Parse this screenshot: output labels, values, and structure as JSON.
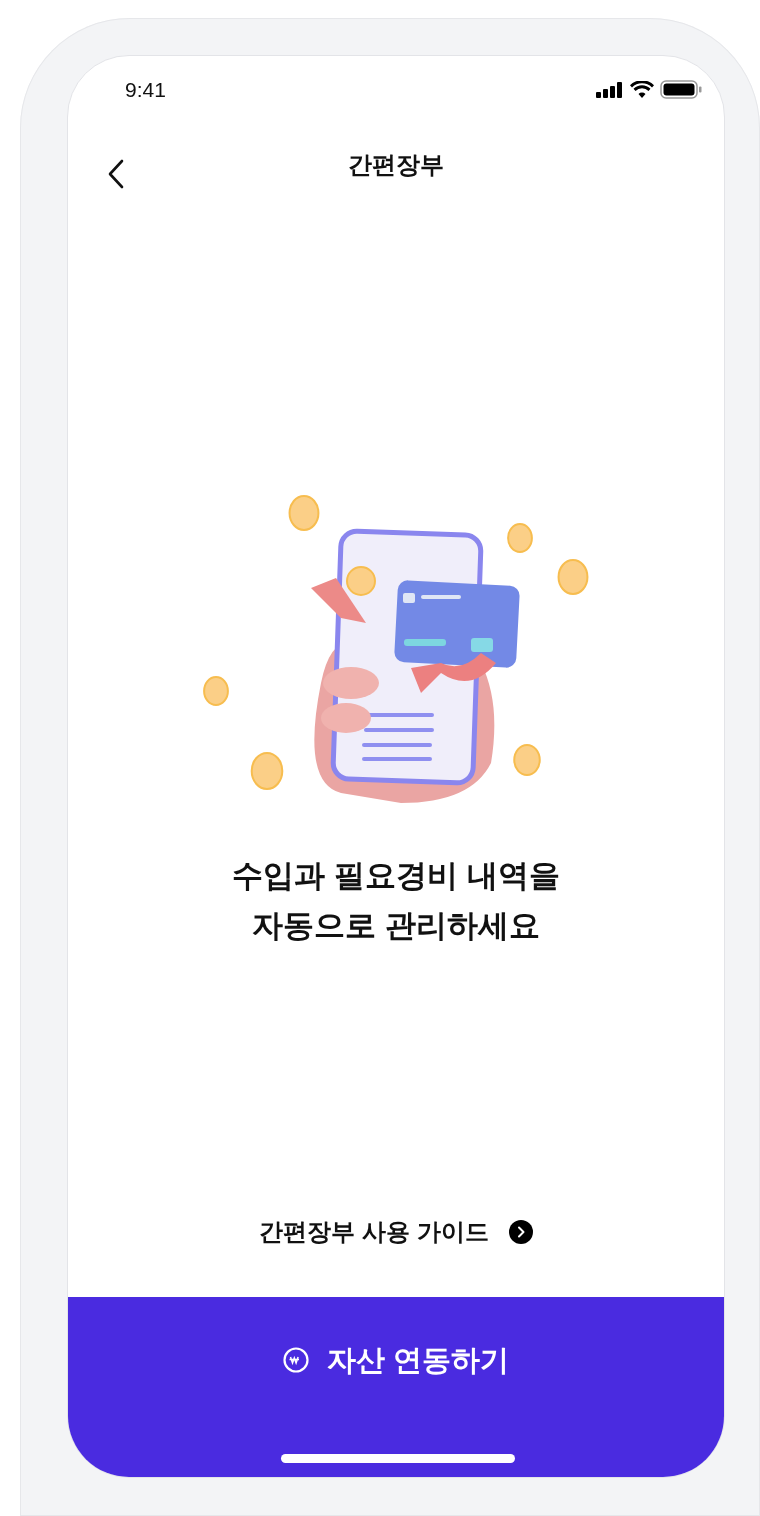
{
  "status_bar": {
    "time": "9:41"
  },
  "nav": {
    "title": "간편장부"
  },
  "headline": [
    "수입과 필요경비 내역을",
    "자동으로 관리하세요"
  ],
  "guide_link": {
    "label": "간편장부 사용 가이드"
  },
  "primary_button": {
    "label": "자산 연동하기"
  }
}
